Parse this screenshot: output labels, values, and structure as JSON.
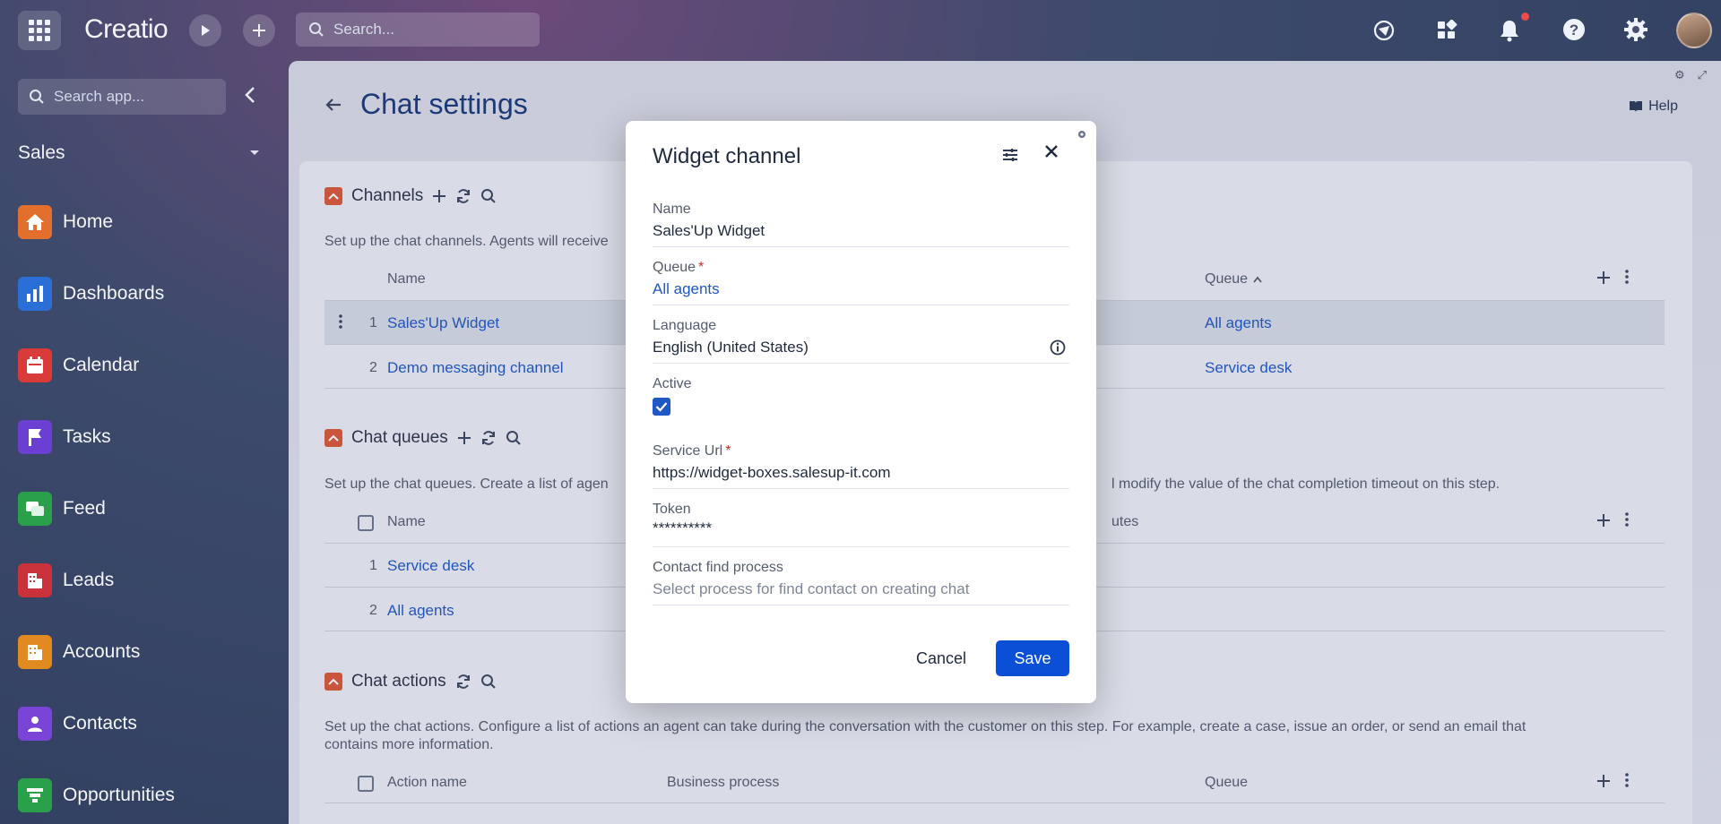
{
  "topbar": {
    "logo": "Creatio",
    "search_placeholder": "Search...",
    "icons": [
      "apps-grid-icon",
      "run-process-icon",
      "add-icon",
      "search-icon",
      "communication-panel-icon",
      "app-designer-icon",
      "notifications-icon",
      "help-icon",
      "settings-icon",
      "user-avatar"
    ]
  },
  "sidebar": {
    "search_placeholder": "Search app...",
    "workspace": "Sales",
    "items": [
      {
        "label": "Home",
        "color": "#e36f2f",
        "icon": "home-icon"
      },
      {
        "label": "Dashboards",
        "color": "#2a6fd6",
        "icon": "dashboard-icon"
      },
      {
        "label": "Calendar",
        "color": "#d93a3a",
        "icon": "calendar-icon"
      },
      {
        "label": "Tasks",
        "color": "#6b3fd1",
        "icon": "flag-icon"
      },
      {
        "label": "Feed",
        "color": "#2aa04a",
        "icon": "chat-icon"
      },
      {
        "label": "Leads",
        "color": "#c9323a",
        "icon": "leads-icon"
      },
      {
        "label": "Accounts",
        "color": "#e08a1f",
        "icon": "building-icon"
      },
      {
        "label": "Contacts",
        "color": "#7a45d6",
        "icon": "person-icon"
      },
      {
        "label": "Opportunities",
        "color": "#2aa04a",
        "icon": "funnel-icon"
      }
    ]
  },
  "page": {
    "title": "Chat settings",
    "help": "Help",
    "channels": {
      "title": "Channels",
      "desc": "Set up the chat channels. Agents will receive",
      "col_name": "Name",
      "col_queue": "Queue",
      "rows": [
        {
          "num": "1",
          "name": "Sales'Up Widget",
          "queue": "All agents"
        },
        {
          "num": "2",
          "name": "Demo messaging channel",
          "queue": "Service desk"
        }
      ]
    },
    "queues": {
      "title": "Chat queues",
      "desc_left": "Set up the chat queues. Create a list of agen",
      "desc_right": "l modify the value of the chat completion timeout on this step.",
      "col_name": "Name",
      "col_right": "utes",
      "rows": [
        {
          "num": "1",
          "name": "Service desk"
        },
        {
          "num": "2",
          "name": "All agents"
        }
      ]
    },
    "actions": {
      "title": "Chat actions",
      "desc_line1": "Set up the chat actions. Configure a list of actions an agent can take during the conversation with the customer on this step. For example, create a case, issue an order, or send an email that",
      "desc_line2": "contains more information.",
      "col_action": "Action name",
      "col_process": "Business process",
      "col_queue": "Queue"
    }
  },
  "modal": {
    "title": "Widget channel",
    "fields": {
      "name": {
        "label": "Name",
        "value": "Sales'Up Widget"
      },
      "queue": {
        "label": "Queue",
        "value": "All agents"
      },
      "language": {
        "label": "Language",
        "value": "English (United States)"
      },
      "active": {
        "label": "Active",
        "checked": true
      },
      "service_url": {
        "label": "Service Url",
        "value": "https://widget-boxes.salesup-it.com"
      },
      "token": {
        "label": "Token",
        "value": "**********"
      },
      "contact_find": {
        "label": "Contact find process",
        "placeholder": "Select process for find contact on creating chat"
      }
    },
    "required_mark": "*",
    "cancel": "Cancel",
    "save": "Save"
  }
}
